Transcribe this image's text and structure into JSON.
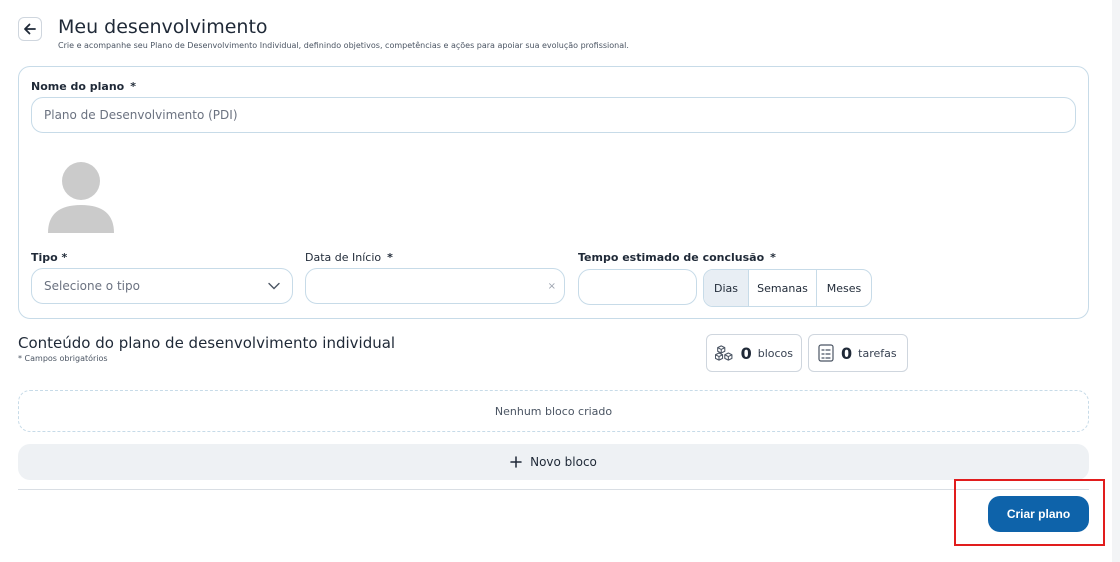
{
  "header": {
    "title": "Meu desenvolvimento",
    "subtitle": "Crie e acompanhe seu Plano de Desenvolvimento Individual, definindo objetivos, competências e ações para apoiar sua evolução profissional."
  },
  "form": {
    "plan_name_label": "Nome do plano",
    "plan_name_required": "*",
    "plan_name_placeholder": "Plano de Desenvolvimento (PDI)",
    "type_label": "Tipo *",
    "type_placeholder": "Selecione o tipo",
    "start_date_label": "Data de Início",
    "start_date_required": "*",
    "start_date_clear": "×",
    "duration_label": "Tempo estimado de conclusão",
    "duration_required": "*",
    "duration_units": [
      "Dias",
      "Semanas",
      "Meses"
    ],
    "duration_selected": "Dias"
  },
  "content": {
    "title": "Conteúdo do plano de desenvolvimento individual",
    "note": "* Campos obrigatórios",
    "blocks_count": "0",
    "blocks_unit": "blocos",
    "tasks_count": "0",
    "tasks_unit": "tarefas",
    "empty_message": "Nenhum bloco criado",
    "new_block_label": "Novo bloco"
  },
  "footer": {
    "create_label": "Criar plano"
  },
  "colors": {
    "primary": "#0e63aa",
    "border": "#c7dbe8",
    "highlight": "#e11d1d"
  }
}
